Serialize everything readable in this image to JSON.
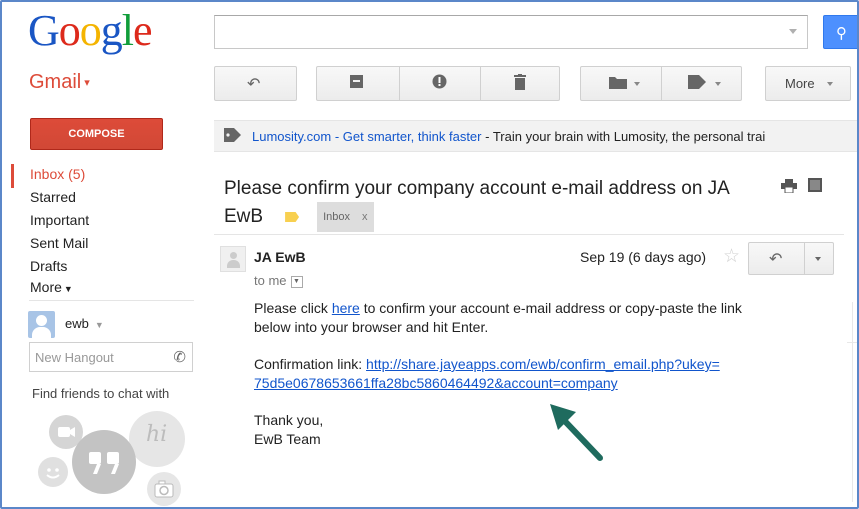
{
  "header": {
    "logo_letters": [
      {
        "ch": "G",
        "color": "#1a56c4"
      },
      {
        "ch": "o",
        "color": "#dd2a1c"
      },
      {
        "ch": "o",
        "color": "#f4b400"
      },
      {
        "ch": "g",
        "color": "#1a56c4"
      },
      {
        "ch": "l",
        "color": "#109d3a"
      },
      {
        "ch": "e",
        "color": "#dd2a1c"
      }
    ],
    "search_value": ""
  },
  "gmail_label": "Gmail",
  "toolbar": {
    "back_icon": "back-arrow-icon",
    "archive_icon": "archive-icon",
    "spam_icon": "report-spam-icon",
    "delete_icon": "trash-icon",
    "move_icon": "folder-icon",
    "labels_icon": "tag-icon",
    "more_label": "More"
  },
  "sidebar": {
    "compose_label": "COMPOSE",
    "items": [
      {
        "label": "Inbox (5)",
        "active": true
      },
      {
        "label": "Starred"
      },
      {
        "label": "Important"
      },
      {
        "label": "Sent Mail"
      },
      {
        "label": "Drafts"
      },
      {
        "label": "More"
      }
    ],
    "user_name": "ewb",
    "hangout_placeholder": "New Hangout",
    "find_friends": "Find friends to chat with",
    "hangout_hi": "hi"
  },
  "ad": {
    "link_text": "Lumosity.com - Get smarter, think faster",
    "rest_text": " - Train your brain with Lumosity, the personal trai"
  },
  "message": {
    "subject_line1": "Please confirm your company account e-mail address on JA",
    "subject_line2": "EwB",
    "label_chip": "Inbox",
    "label_close": "x",
    "sender": "JA EwB",
    "to": "to me",
    "date": "Sep 19 (6 days ago)",
    "body_prefix": "Please click ",
    "body_link": "here",
    "body_suffix": " to confirm your account e-mail address or copy-paste the link",
    "body_line2": "below into your browser and hit Enter.",
    "confirm_label": "Confirmation link: ",
    "confirm_url_1": "http://share.jayeapps.com/ewb/confirm_email.php?ukey=",
    "confirm_url_2": "75d5e0678653661ffa28bc5860464492&account=company",
    "signoff_1": "Thank you,",
    "signoff_2": "EwB Team"
  },
  "colors": {
    "gmail_red": "#dd4b39",
    "link_blue": "#1155cc",
    "search_blue": "#4d90fe",
    "annotation_arrow": "#1f6b5e"
  }
}
